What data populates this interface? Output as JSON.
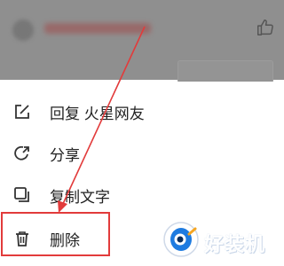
{
  "menu": {
    "items": [
      {
        "label": "回复 火星网友",
        "icon": "edit-icon"
      },
      {
        "label": "分享",
        "icon": "share-icon"
      },
      {
        "label": "复制文字",
        "icon": "copy-icon"
      },
      {
        "label": "删除",
        "icon": "trash-icon"
      }
    ]
  },
  "watermark": {
    "text": "好装机"
  },
  "colors": {
    "highlight": "#e23b3b",
    "dim": "#8f8f8f",
    "watermark_blue": "#1e7be0"
  }
}
